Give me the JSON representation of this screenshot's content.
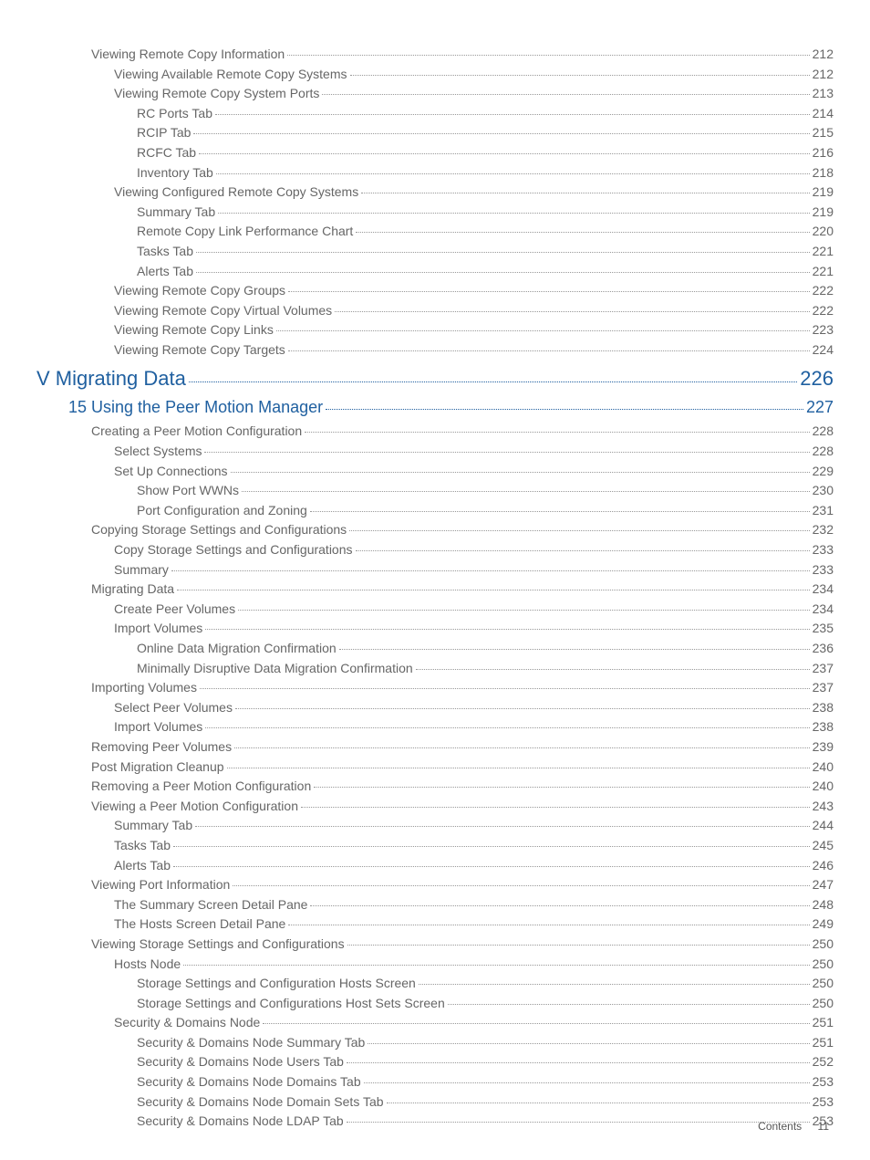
{
  "entries": [
    {
      "title": "Viewing Remote Copy Information",
      "page": "212",
      "indent": 0,
      "style": "normal"
    },
    {
      "title": "Viewing Available Remote Copy Systems",
      "page": "212",
      "indent": 1,
      "style": "normal"
    },
    {
      "title": "Viewing Remote Copy System Ports",
      "page": "213",
      "indent": 1,
      "style": "normal"
    },
    {
      "title": "RC Ports Tab",
      "page": "214",
      "indent": 2,
      "style": "normal"
    },
    {
      "title": "RCIP Tab",
      "page": "215",
      "indent": 2,
      "style": "normal"
    },
    {
      "title": "RCFC Tab",
      "page": "216",
      "indent": 2,
      "style": "normal"
    },
    {
      "title": "Inventory Tab",
      "page": "218",
      "indent": 2,
      "style": "normal"
    },
    {
      "title": "Viewing Configured Remote Copy Systems",
      "page": "219",
      "indent": 1,
      "style": "normal"
    },
    {
      "title": "Summary Tab",
      "page": "219",
      "indent": 2,
      "style": "normal"
    },
    {
      "title": "Remote Copy Link Performance Chart",
      "page": "220",
      "indent": 2,
      "style": "normal"
    },
    {
      "title": "Tasks Tab",
      "page": "221",
      "indent": 2,
      "style": "normal"
    },
    {
      "title": "Alerts Tab",
      "page": "221",
      "indent": 2,
      "style": "normal"
    },
    {
      "title": "Viewing Remote Copy Groups",
      "page": "222",
      "indent": 1,
      "style": "normal"
    },
    {
      "title": "Viewing Remote Copy Virtual Volumes",
      "page": "222",
      "indent": 1,
      "style": "normal"
    },
    {
      "title": "Viewing Remote Copy Links",
      "page": "223",
      "indent": 1,
      "style": "normal"
    },
    {
      "title": "Viewing Remote Copy Targets",
      "page": "224",
      "indent": 1,
      "style": "normal"
    },
    {
      "title": "V Migrating Data",
      "page": "226",
      "indent": 0,
      "style": "part"
    },
    {
      "title": "15 Using the Peer Motion Manager",
      "page": "227",
      "indent": 0,
      "style": "chapter"
    },
    {
      "title": "Creating a Peer Motion Configuration",
      "page": "228",
      "indent": 0,
      "style": "normal"
    },
    {
      "title": "Select Systems",
      "page": "228",
      "indent": 1,
      "style": "normal"
    },
    {
      "title": "Set Up Connections",
      "page": "229",
      "indent": 1,
      "style": "normal"
    },
    {
      "title": "Show Port WWNs",
      "page": "230",
      "indent": 2,
      "style": "normal"
    },
    {
      "title": "Port Configuration and Zoning",
      "page": "231",
      "indent": 2,
      "style": "normal"
    },
    {
      "title": "Copying Storage Settings and Configurations",
      "page": "232",
      "indent": 0,
      "style": "normal"
    },
    {
      "title": "Copy Storage Settings and Configurations",
      "page": "233",
      "indent": 1,
      "style": "normal"
    },
    {
      "title": "Summary",
      "page": "233",
      "indent": 1,
      "style": "normal"
    },
    {
      "title": "Migrating Data ",
      "page": "234",
      "indent": 0,
      "style": "normal"
    },
    {
      "title": "Create Peer Volumes",
      "page": "234",
      "indent": 1,
      "style": "normal"
    },
    {
      "title": "Import Volumes",
      "page": "235",
      "indent": 1,
      "style": "normal"
    },
    {
      "title": "Online Data Migration Confirmation",
      "page": "236",
      "indent": 2,
      "style": "normal"
    },
    {
      "title": "Minimally Disruptive Data Migration Confirmation",
      "page": "237",
      "indent": 2,
      "style": "normal"
    },
    {
      "title": "Importing Volumes",
      "page": "237",
      "indent": 0,
      "style": "normal"
    },
    {
      "title": "Select Peer Volumes",
      "page": "238",
      "indent": 1,
      "style": "normal"
    },
    {
      "title": "Import Volumes",
      "page": "238",
      "indent": 1,
      "style": "normal"
    },
    {
      "title": "Removing Peer Volumes ",
      "page": "239",
      "indent": 0,
      "style": "normal"
    },
    {
      "title": "Post Migration Cleanup ",
      "page": "240",
      "indent": 0,
      "style": "normal"
    },
    {
      "title": "Removing a Peer Motion Configuration ",
      "page": "240",
      "indent": 0,
      "style": "normal"
    },
    {
      "title": "Viewing a Peer Motion Configuration",
      "page": "243",
      "indent": 0,
      "style": "normal"
    },
    {
      "title": "Summary Tab",
      "page": "244",
      "indent": 1,
      "style": "normal"
    },
    {
      "title": "Tasks Tab",
      "page": "245",
      "indent": 1,
      "style": "normal"
    },
    {
      "title": "Alerts Tab",
      "page": "246",
      "indent": 1,
      "style": "normal"
    },
    {
      "title": "Viewing Port Information",
      "page": "247",
      "indent": 0,
      "style": "normal"
    },
    {
      "title": "The Summary Screen Detail Pane",
      "page": "248",
      "indent": 1,
      "style": "normal"
    },
    {
      "title": "The Hosts Screen Detail Pane",
      "page": "249",
      "indent": 1,
      "style": "normal"
    },
    {
      "title": "Viewing Storage Settings and Configurations",
      "page": "250",
      "indent": 0,
      "style": "normal"
    },
    {
      "title": "Hosts Node",
      "page": "250",
      "indent": 1,
      "style": "normal"
    },
    {
      "title": "Storage Settings and Configuration Hosts Screen",
      "page": "250",
      "indent": 2,
      "style": "normal"
    },
    {
      "title": "Storage Settings and Configurations Host Sets Screen",
      "page": "250",
      "indent": 2,
      "style": "normal"
    },
    {
      "title": "Security & Domains Node",
      "page": "251",
      "indent": 1,
      "style": "normal"
    },
    {
      "title": "Security & Domains Node Summary Tab",
      "page": "251",
      "indent": 2,
      "style": "normal"
    },
    {
      "title": "Security & Domains Node Users Tab",
      "page": "252",
      "indent": 2,
      "style": "normal"
    },
    {
      "title": "Security & Domains Node Domains Tab",
      "page": "253",
      "indent": 2,
      "style": "normal"
    },
    {
      "title": "Security & Domains Node Domain Sets Tab",
      "page": "253",
      "indent": 2,
      "style": "normal"
    },
    {
      "title": "Security & Domains Node LDAP Tab",
      "page": "253",
      "indent": 2,
      "style": "normal"
    }
  ],
  "footer": {
    "label": "Contents",
    "page": "11"
  }
}
